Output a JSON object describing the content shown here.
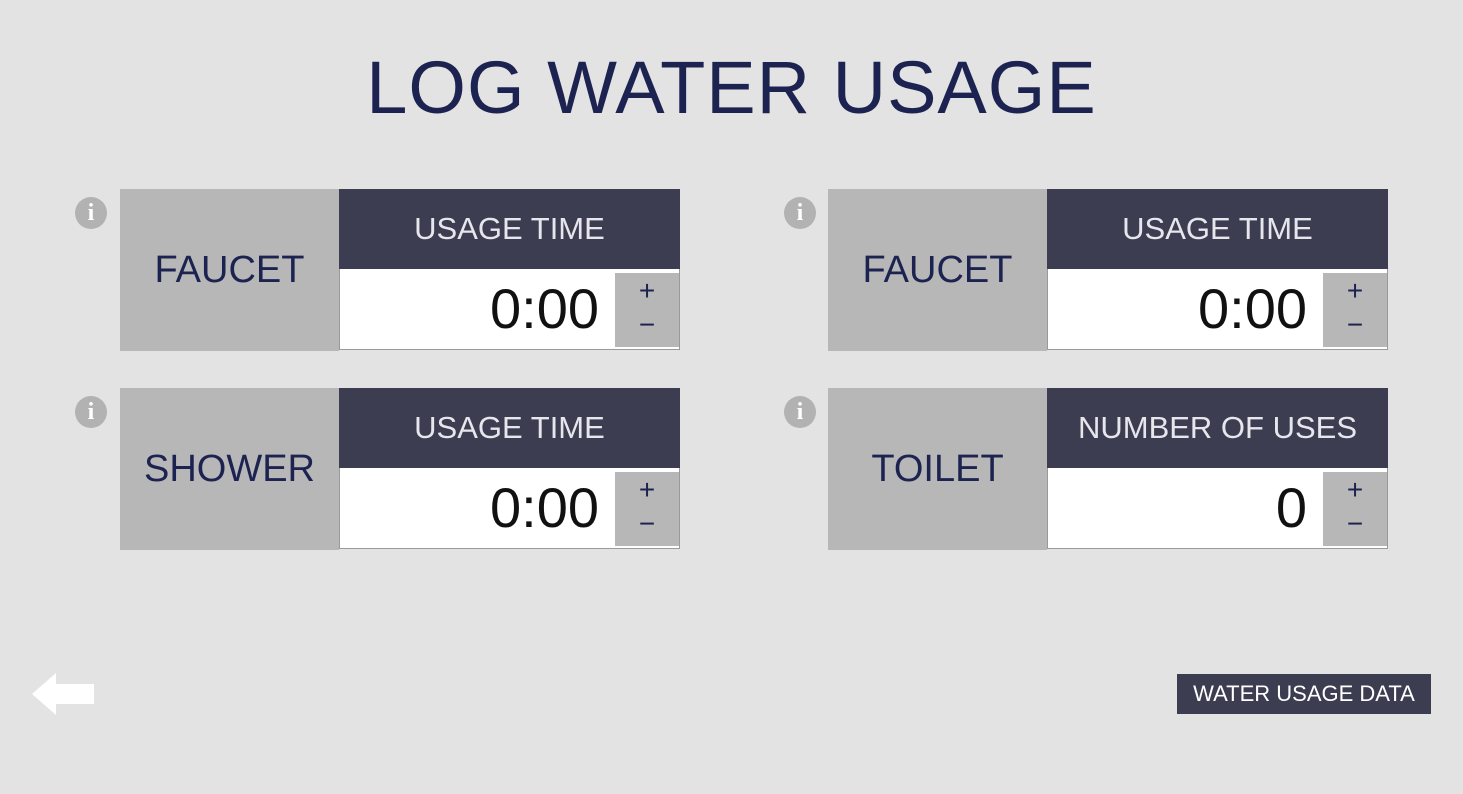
{
  "page": {
    "title": "LOG WATER USAGE"
  },
  "cards": [
    {
      "label": "FAUCET",
      "header": "USAGE TIME",
      "value": "0:00",
      "plus": "+",
      "minus": "−",
      "info_icon": "info-icon"
    },
    {
      "label": "FAUCET",
      "header": "USAGE TIME",
      "value": "0:00",
      "plus": "+",
      "minus": "−",
      "info_icon": "info-icon"
    },
    {
      "label": "SHOWER",
      "header": "USAGE TIME",
      "value": "0:00",
      "plus": "+",
      "minus": "−",
      "info_icon": "info-icon"
    },
    {
      "label": "TOILET",
      "header": "NUMBER OF USES",
      "value": "0",
      "plus": "+",
      "minus": "−",
      "info_icon": "info-icon"
    }
  ],
  "footer": {
    "back_icon": "back-arrow-icon",
    "data_button_label": "WATER USAGE DATA"
  },
  "colors": {
    "background": "#e3e3e3",
    "title": "#1d2350",
    "header_bg": "#3d3d52",
    "label_bg": "#b7b7b7",
    "value_bg": "#ffffff"
  }
}
